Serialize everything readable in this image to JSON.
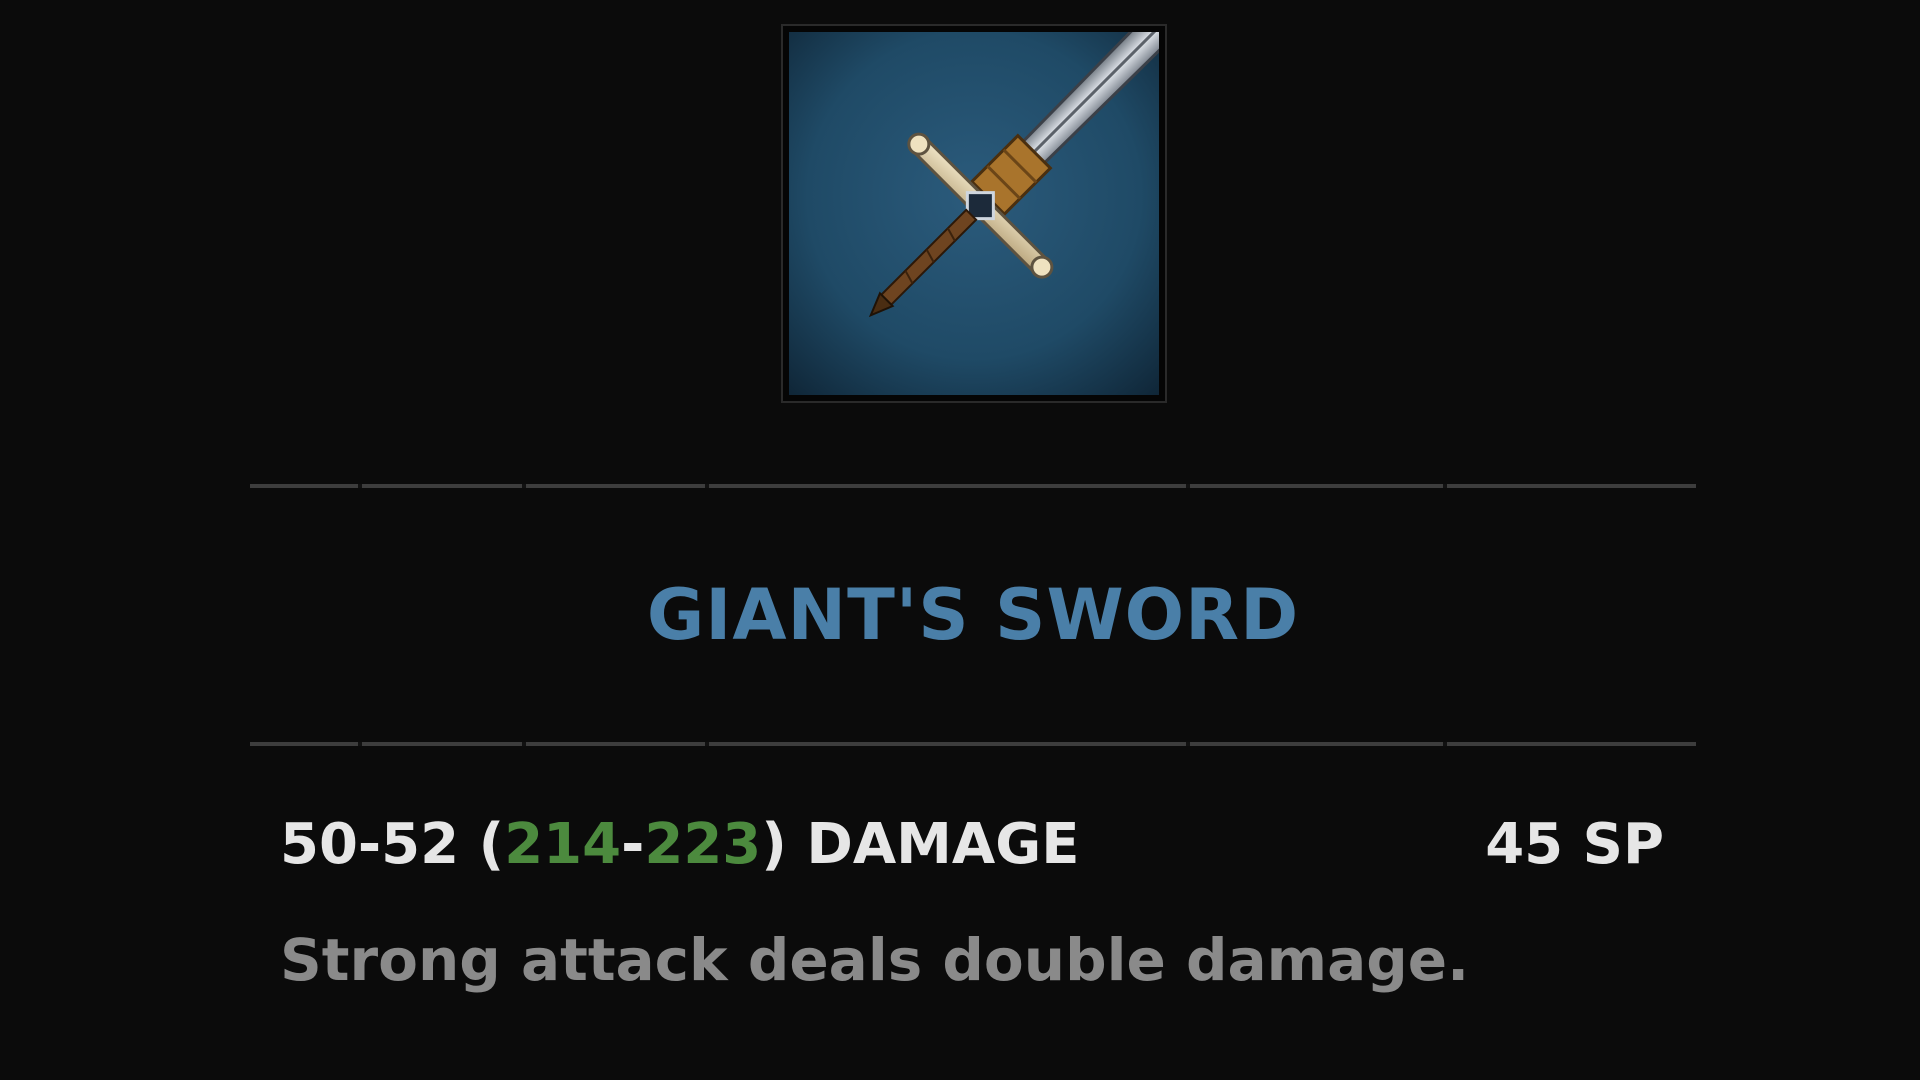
{
  "item": {
    "name": "GIANT'S SWORD",
    "icon": "giants-sword-icon",
    "damage": {
      "base_range": "50-52",
      "open_paren": "(",
      "scaled_min": "214",
      "dash": "-",
      "scaled_max": "223",
      "close_paren": ")",
      "label": "DAMAGE"
    },
    "sp_cost": "45 SP",
    "description": "Strong attack deals double damage."
  },
  "colors": {
    "background": "#0b0b0b",
    "name": "#4a7fa8",
    "scaled_damage": "#4c8a3e",
    "primary_text": "#e6e6e6",
    "description_text": "#8a8a8a",
    "icon_background": "#1f4a66"
  }
}
